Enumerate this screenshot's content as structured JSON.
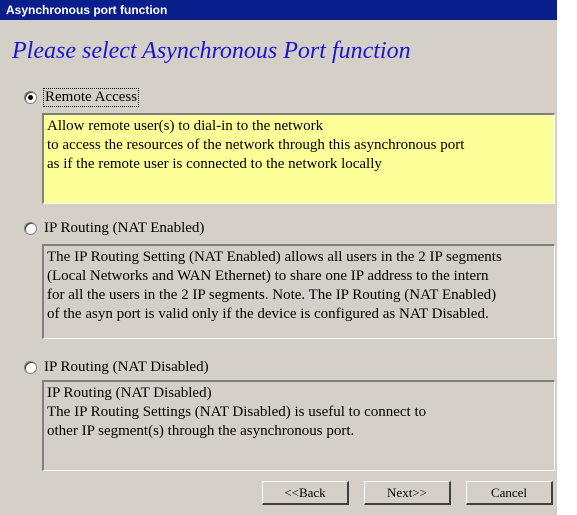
{
  "window": {
    "title": "Asynchronous port function"
  },
  "heading": "Please select Asynchronous Port function",
  "options": [
    {
      "label": "Remote Access",
      "selected": true,
      "description": [
        "Allow remote user(s) to dial-in to the network",
        "to access the resources of the network through this asynchronous port",
        "as if the remote user is connected to the network locally"
      ]
    },
    {
      "label": "IP Routing (NAT Enabled)",
      "selected": false,
      "description": [
        "The IP Routing Setting (NAT Enabled) allows all users in the 2 IP segments",
        "(Local Networks and WAN Ethernet) to share one IP address to the intern",
        "for all the users in the 2 IP segments. Note. The IP Routing (NAT Enabled)",
        "of the asyn port is valid only if the device is configured as NAT Disabled."
      ]
    },
    {
      "label": "IP Routing (NAT Disabled)",
      "selected": false,
      "description": [
        "IP Routing (NAT Disabled)",
        "The IP Routing Settings (NAT Disabled) is useful to connect to",
        "other IP segment(s) through the asynchronous port."
      ]
    }
  ],
  "buttons": {
    "back": "<<Back",
    "next": "Next>>",
    "cancel": "Cancel"
  },
  "colors": {
    "titlebar": "#0a1f8c",
    "heading": "#1a14d8",
    "active_box": "#ffff99",
    "dialog_bg": "#d4d0c8"
  }
}
